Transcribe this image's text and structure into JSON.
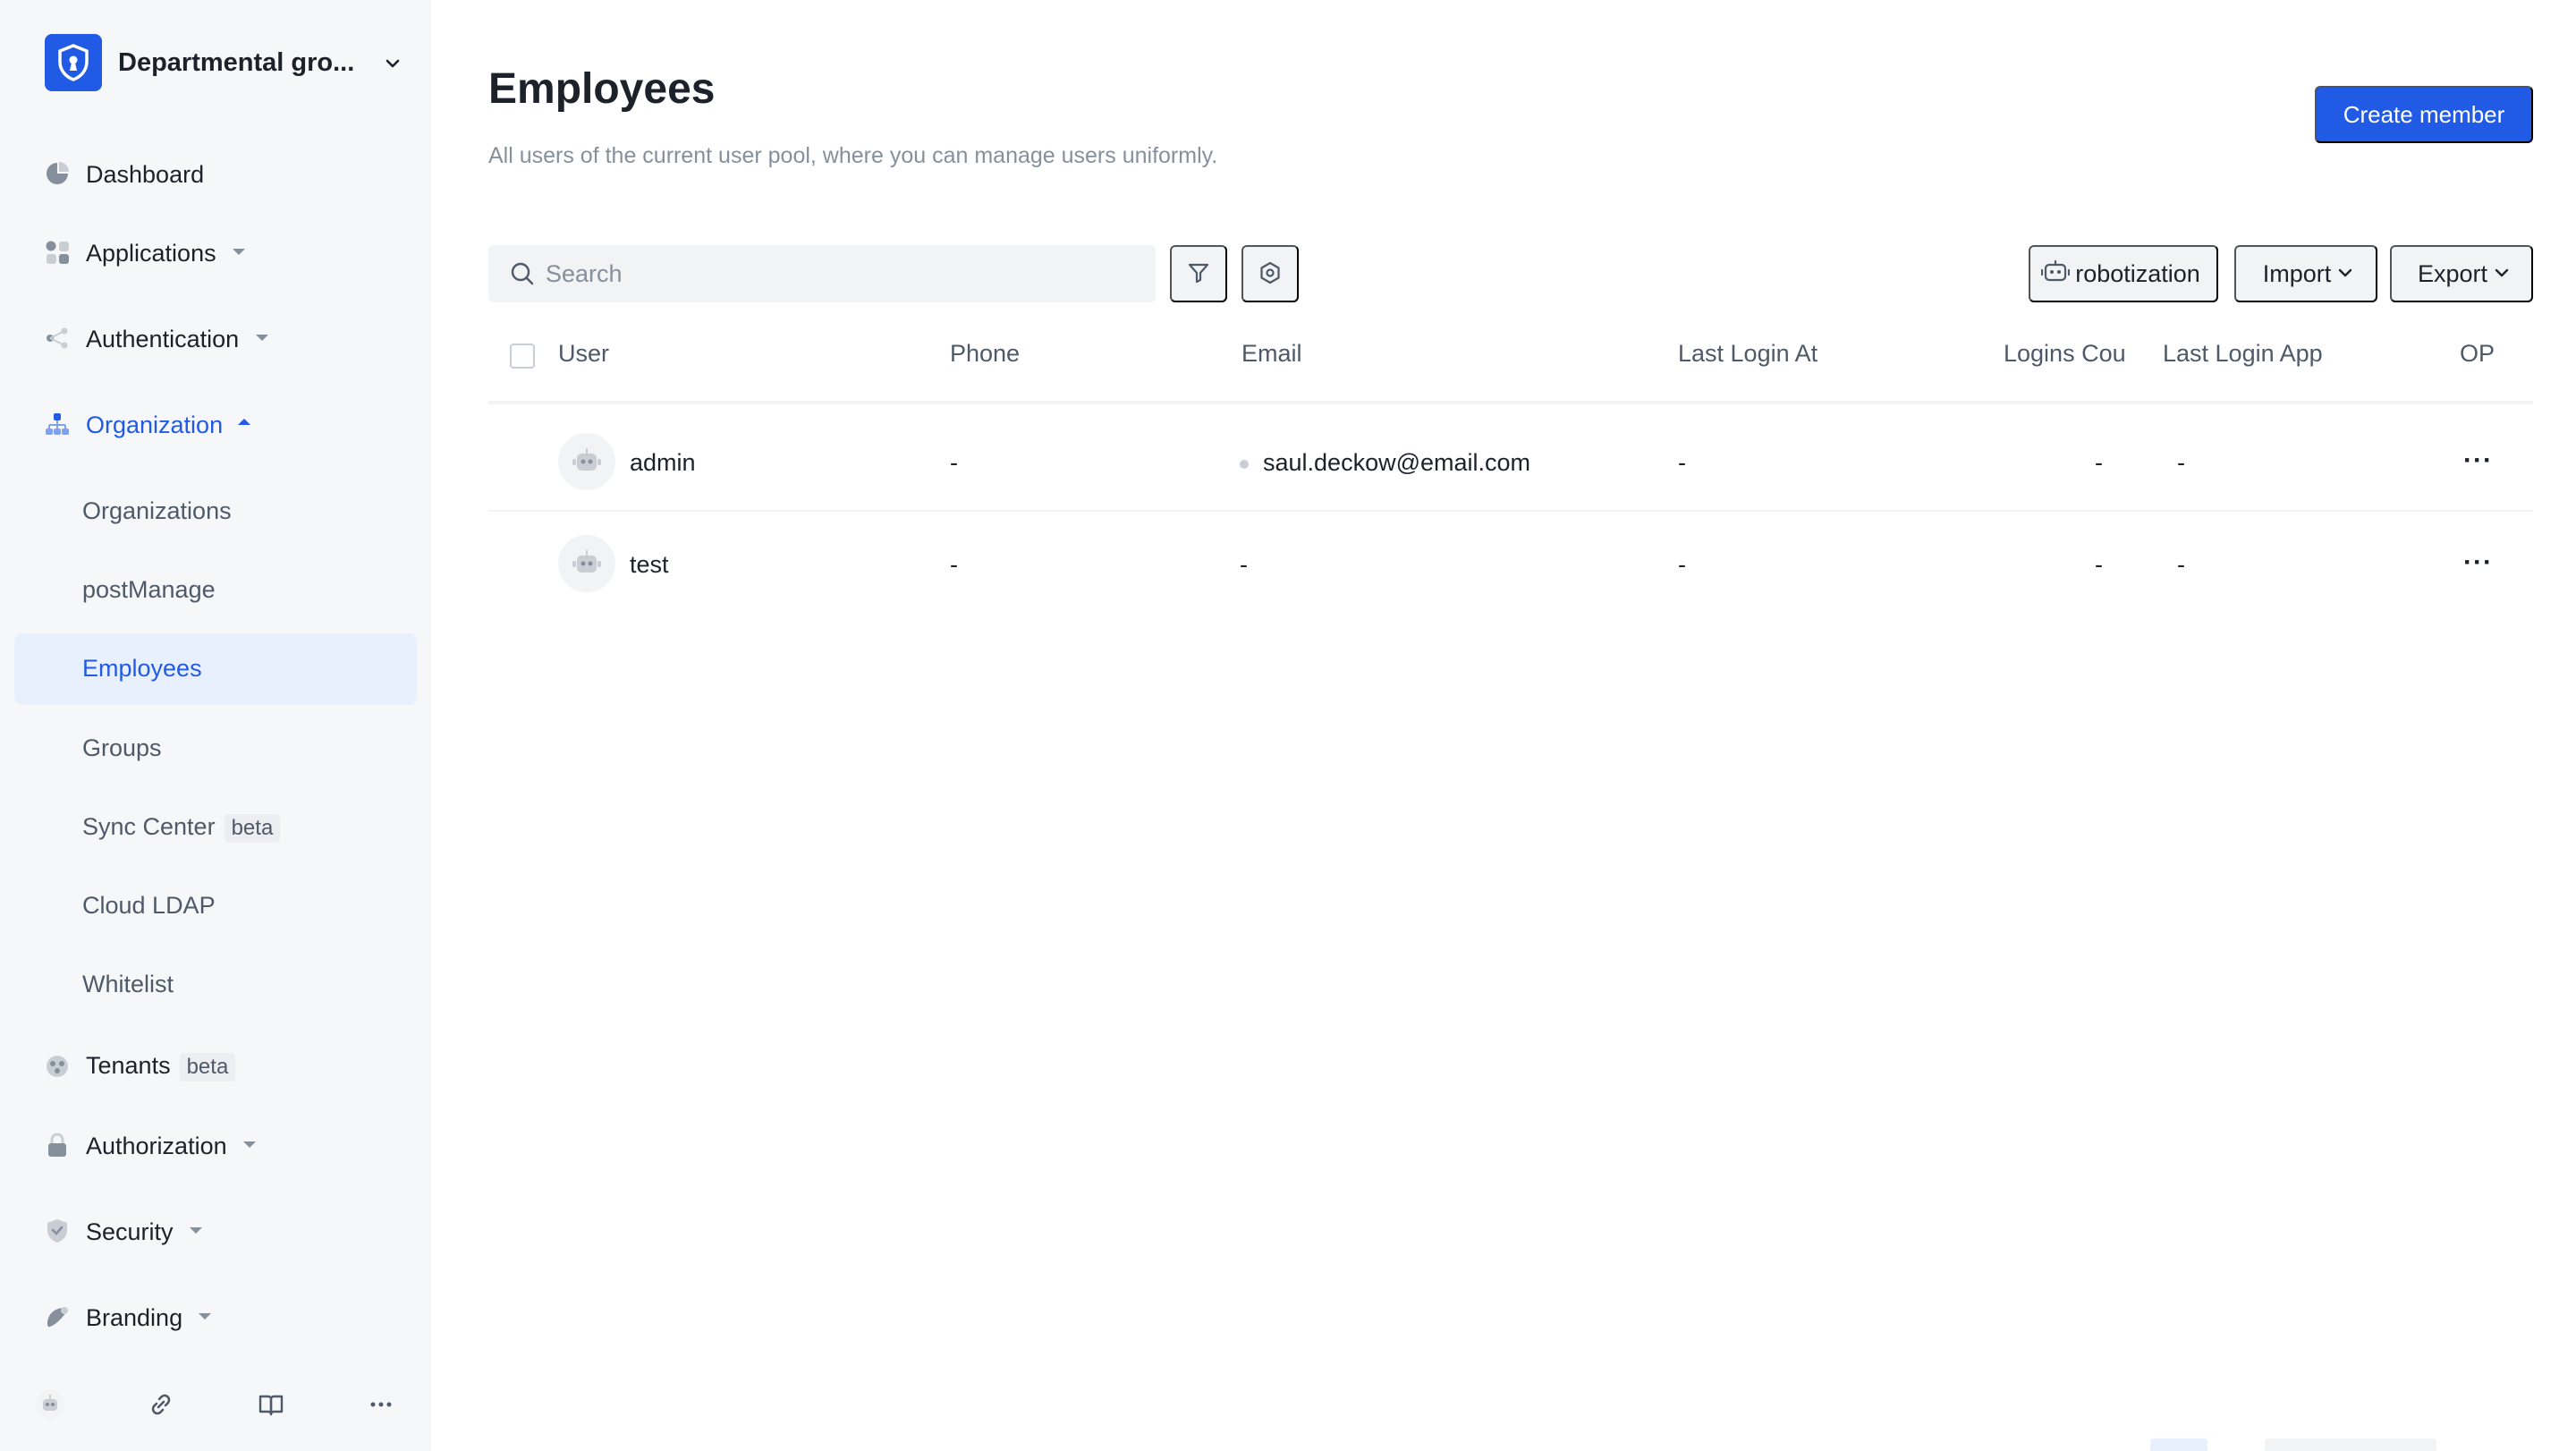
{
  "workspace": {
    "name": "Departmental gro...",
    "accent": "#215ae5"
  },
  "sidebar": {
    "items": [
      {
        "label": "Dashboard"
      },
      {
        "label": "Applications"
      },
      {
        "label": "Authentication"
      },
      {
        "label": "Organization"
      },
      {
        "label": "Tenants",
        "badge": "beta"
      },
      {
        "label": "Authorization"
      },
      {
        "label": "Security"
      },
      {
        "label": "Branding"
      }
    ],
    "organization_sub": [
      {
        "label": "Organizations"
      },
      {
        "label": "postManage"
      },
      {
        "label": "Employees",
        "selected": true
      },
      {
        "label": "Groups"
      },
      {
        "label": "Sync Center",
        "badge": "beta"
      },
      {
        "label": "Cloud LDAP"
      },
      {
        "label": "Whitelist"
      }
    ],
    "footer_icons": [
      "robot-avatar-icon",
      "link-icon",
      "book-icon",
      "more-icon"
    ]
  },
  "header": {
    "title": "Employees",
    "subtitle": "All users of the current user pool, where you can manage users uniformly.",
    "create_label": "Create member"
  },
  "toolbar": {
    "search_placeholder": "Search",
    "robotization_label": "robotization",
    "import_label": "Import",
    "export_label": "Export"
  },
  "table": {
    "columns": [
      "User",
      "Phone",
      "Email",
      "Last Login At",
      "Logins Cou",
      "Last Login App",
      "OP"
    ],
    "rows": [
      {
        "user": "admin",
        "phone": "-",
        "email": "saul.deckow@email.com",
        "last_login_at": "-",
        "logins_count": "-",
        "last_login_app": "-",
        "op": "···"
      },
      {
        "user": "test",
        "phone": "-",
        "email": "-",
        "last_login_at": "-",
        "logins_count": "-",
        "last_login_app": "-",
        "op": "···"
      }
    ]
  }
}
